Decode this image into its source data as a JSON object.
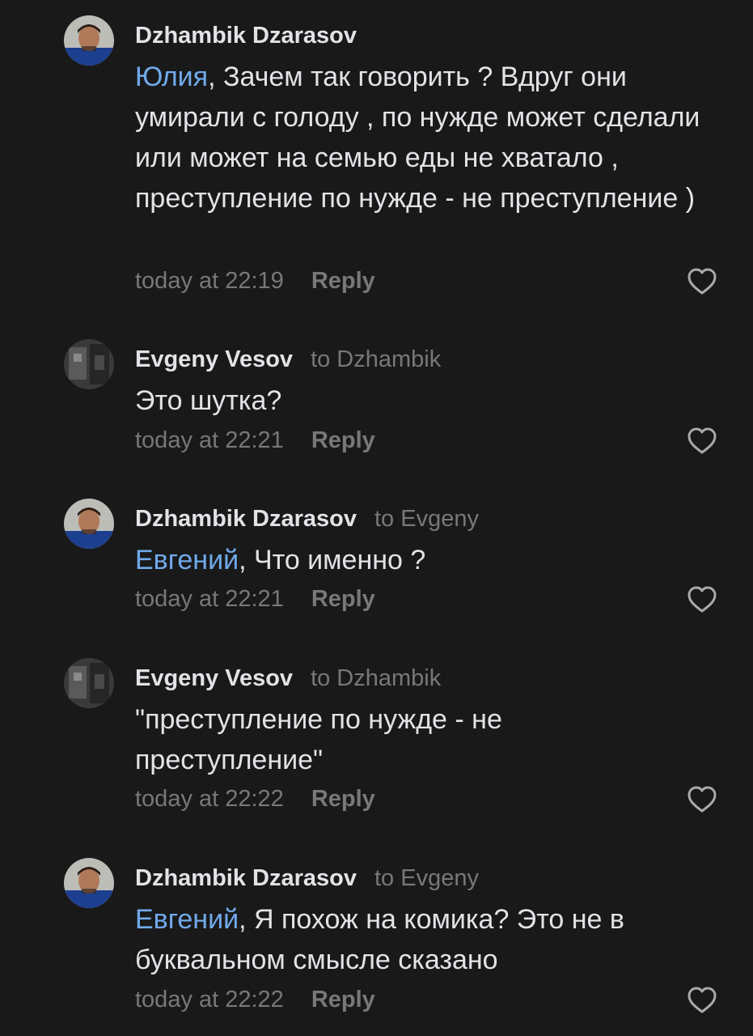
{
  "comments": [
    {
      "author": "Dzhambik Dzarasov",
      "reply_to": "",
      "mention": "Юлия",
      "text": ", Зачем так говорить ? Вдруг они умирали с голоду , по нужде может сделали или может на семью еды не хватало , преступление по нужде - не преступление )",
      "time": "today at 22:19",
      "reply_label": "Reply",
      "avatar": "dzhambik-avatar"
    },
    {
      "author": "Evgeny Vesov",
      "reply_to": "to Dzhambik",
      "mention": "",
      "text": "Это шутка?",
      "time": "today at 22:21",
      "reply_label": "Reply",
      "avatar": "evgeny-avatar"
    },
    {
      "author": "Dzhambik Dzarasov",
      "reply_to": "to Evgeny",
      "mention": "Евгений",
      "text": ", Что именно ?",
      "time": "today at 22:21",
      "reply_label": "Reply",
      "avatar": "dzhambik-avatar"
    },
    {
      "author": "Evgeny Vesov",
      "reply_to": "to Dzhambik",
      "mention": "",
      "text": "\"преступление по нужде - не преступление\"",
      "time": "today at 22:22",
      "reply_label": "Reply",
      "avatar": "evgeny-avatar"
    },
    {
      "author": "Dzhambik Dzarasov",
      "reply_to": "to Evgeny",
      "mention": "Евгений",
      "text": ", Я похож на комика? Это не в буквальном смысле сказано",
      "time": "today at 22:22",
      "reply_label": "Reply",
      "avatar": "dzhambik-avatar"
    }
  ],
  "icons": {
    "like": "heart-outline-icon"
  },
  "colors": {
    "background": "#19191a",
    "text": "#e1e3e6",
    "secondary": "#76787a",
    "mention": "#71aaeb"
  }
}
